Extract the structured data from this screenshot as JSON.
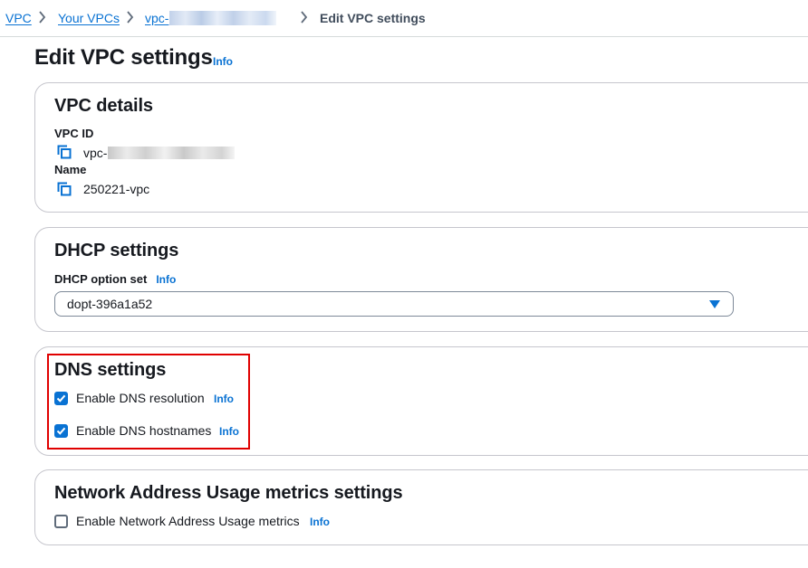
{
  "breadcrumb": {
    "items": [
      "VPC",
      "Your VPCs",
      "vpc-",
      "Edit VPC settings"
    ]
  },
  "page": {
    "title": "Edit VPC settings",
    "info": "Info"
  },
  "vpc_details": {
    "heading": "VPC details",
    "vpc_id_label": "VPC ID",
    "vpc_id_value": "vpc-",
    "name_label": "Name",
    "name_value": "250221-vpc"
  },
  "dhcp": {
    "heading": "DHCP settings",
    "option_set_label": "DHCP option set",
    "info": "Info",
    "selected": "dopt-396a1a52"
  },
  "dns": {
    "heading": "DNS settings",
    "resolution_label": "Enable DNS resolution",
    "resolution_checked": true,
    "hostnames_label": "Enable DNS hostnames",
    "hostnames_checked": true,
    "info": "Info"
  },
  "nau": {
    "heading": "Network Address Usage metrics settings",
    "metrics_label": "Enable Network Address Usage metrics",
    "metrics_checked": false,
    "info": "Info"
  },
  "colors": {
    "link": "#0972d3",
    "highlight": "#e00000",
    "border": "#c6c6cd"
  },
  "icons": [
    "chevron-right-icon",
    "copy-icon",
    "caret-down-icon",
    "checkmark-icon"
  ]
}
